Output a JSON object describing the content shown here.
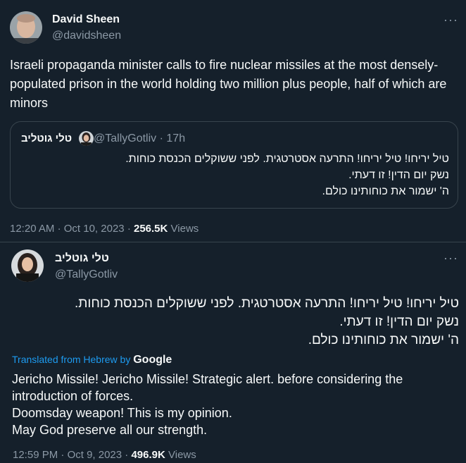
{
  "tweet1": {
    "display_name": "David Sheen",
    "handle": "@davidsheen",
    "more_glyph": "···",
    "text": "Israeli propaganda minister calls to fire nuclear missiles at the most densely-populated prison in the world holding two million plus people, half of which are minors",
    "quote": {
      "display_name": "טלי גוטליב",
      "handle": "@TallyGotliv",
      "sep": "·",
      "time": "17h",
      "lines": [
        "טיל יריחו! טיל יריחו! התרעה אסטרטגית. לפני ששוקלים הכנסת כוחות.",
        "נשק יום הדין! זו דעתי.",
        "ה' ישמור את כוחותינו כולם."
      ]
    },
    "meta": {
      "time": "12:20 AM",
      "sep1": "·",
      "date": "Oct 10, 2023",
      "sep2": "·",
      "views": "256.5K",
      "views_label": "Views"
    }
  },
  "tweet2": {
    "display_name": "טלי גוטליב",
    "handle": "@TallyGotliv",
    "more_glyph": "···",
    "lines": [
      "טיל יריחו! טיל יריחו! התרעה אסטרטגית. לפני ששוקלים הכנסת כוחות.",
      "נשק יום הדין! זו דעתי.",
      "ה' ישמור את כוחותינו כולם."
    ],
    "translated_prefix": "Translated from Hebrew by",
    "translator": "Google",
    "translation_lines": [
      "Jericho Missile! Jericho Missile! Strategic alert. before considering the",
      "introduction of forces.",
      "Doomsday weapon! This is my opinion.",
      "May God preserve all our strength."
    ],
    "meta": {
      "time": "12:59 PM",
      "sep1": "·",
      "date": "Oct 9, 2023",
      "sep2": "·",
      "views": "496.9K",
      "views_label": "Views"
    }
  },
  "colors": {
    "background": "#15202b",
    "text": "#f7f9f9",
    "secondary": "#8b98a5",
    "link": "#1d9bf0",
    "border": "#38444d"
  }
}
